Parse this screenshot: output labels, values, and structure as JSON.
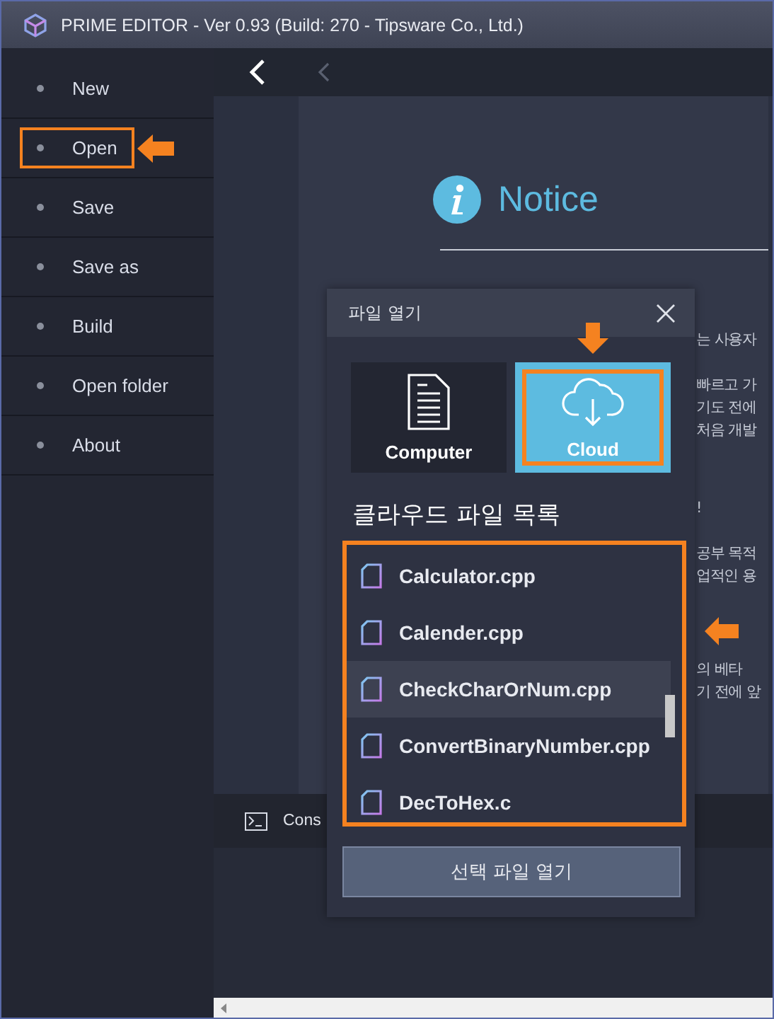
{
  "window": {
    "title": "PRIME EDITOR - Ver 0.93 (Build: 270 - Tipsware Co., Ltd.)"
  },
  "sidebar": {
    "items": [
      {
        "label": "New",
        "highlighted": false
      },
      {
        "label": "Open",
        "highlighted": true
      },
      {
        "label": "Save",
        "highlighted": false
      },
      {
        "label": "Save as",
        "highlighted": false
      },
      {
        "label": "Build",
        "highlighted": false
      },
      {
        "label": "Open folder",
        "highlighted": false
      },
      {
        "label": "About",
        "highlighted": false
      }
    ]
  },
  "nav": {
    "back_enabled": true,
    "forward_enabled": false
  },
  "notice": {
    "title": "Notice",
    "paragraphs": [
      [
        "는 사용자"
      ],
      [
        "빠르고 가",
        "기도 전에",
        "처음 개발"
      ],
      [
        "!"
      ],
      [
        "공부 목적",
        "업적인 용"
      ],
      [
        "의 베타",
        "기 전에 앞"
      ]
    ]
  },
  "console": {
    "label": "Cons"
  },
  "dialog": {
    "title": "파일 열기",
    "sources": [
      {
        "kind": "computer",
        "label": "Computer",
        "selected": false,
        "highlighted": false
      },
      {
        "kind": "cloud",
        "label": "Cloud",
        "selected": true,
        "highlighted": true
      }
    ],
    "list_heading": "클라우드 파일 목록",
    "list_highlighted": true,
    "files": [
      {
        "name": "Calculator.cpp",
        "selected": false
      },
      {
        "name": "Calender.cpp",
        "selected": false
      },
      {
        "name": "CheckCharOrNum.cpp",
        "selected": true
      },
      {
        "name": "ConvertBinaryNumber.cpp",
        "selected": false
      },
      {
        "name": "DecToHex.c",
        "selected": false
      }
    ],
    "open_button": "선택 파일 열기"
  }
}
